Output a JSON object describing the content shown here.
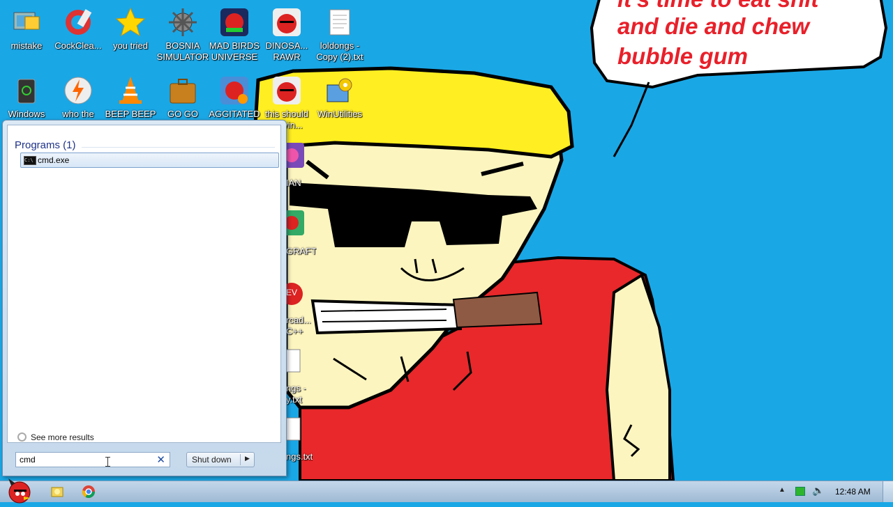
{
  "desktop": {
    "icons": [
      {
        "label": "mistake",
        "icon": "computer-icon"
      },
      {
        "label": "CockClea...",
        "icon": "ccleaner-icon"
      },
      {
        "label": "you tried",
        "icon": "star-icon"
      },
      {
        "label": "BOSNIA\nSIMULATOR",
        "icon": "spiked-ball-icon"
      },
      {
        "label": "MAD BIRDS\nUNIVERSE",
        "icon": "angry-birds-space-icon"
      },
      {
        "label": "DINOSA...\nRAWR",
        "icon": "angry-bird-icon"
      },
      {
        "label": "loldongs -\nCopy (2).txt",
        "icon": "text-file-icon"
      },
      {
        "label": "Windows",
        "icon": "recycle-bin-icon"
      },
      {
        "label": "who the",
        "icon": "winamp-icon"
      },
      {
        "label": "BEEP BEEP",
        "icon": "vlc-cone-icon"
      },
      {
        "label": "GO GO",
        "icon": "briefcase-icon"
      },
      {
        "label": "AGGITATED",
        "icon": "angry-birds-rio-icon"
      },
      {
        "label": "this should\nbe vin...",
        "icon": "angry-bird-icon"
      },
      {
        "label": "WinUtilities",
        "icon": "gears-icon"
      }
    ],
    "partial_icons": [
      {
        "label": "IAN"
      },
      {
        "label": "GRAFT"
      },
      {
        "label": "rcad...\nC++"
      },
      {
        "label": "ngs -\ny.txt"
      },
      {
        "label": "ngs.txt"
      }
    ],
    "speech_bubble_lines": [
      "it's time to eat shit",
      "and die and chew",
      "bubble gum"
    ]
  },
  "start_menu": {
    "programs_header": "Programs (1)",
    "results": [
      {
        "label": "cmd.exe",
        "icon": "cmd-icon"
      }
    ],
    "see_more": "See more results",
    "search_value": "cmd",
    "shutdown_label": "Shut down"
  },
  "taskbar": {
    "clock": "12:48 AM",
    "pinned": [
      "explorer-icon",
      "chrome-icon"
    ]
  },
  "colors": {
    "desktop_bg": "#1aa7e6",
    "hat": "#ffee22",
    "shirt": "#e8282a",
    "skin": "#fdf5bf",
    "cigar": "#8f5a43",
    "speech_text": "#e8202a"
  }
}
